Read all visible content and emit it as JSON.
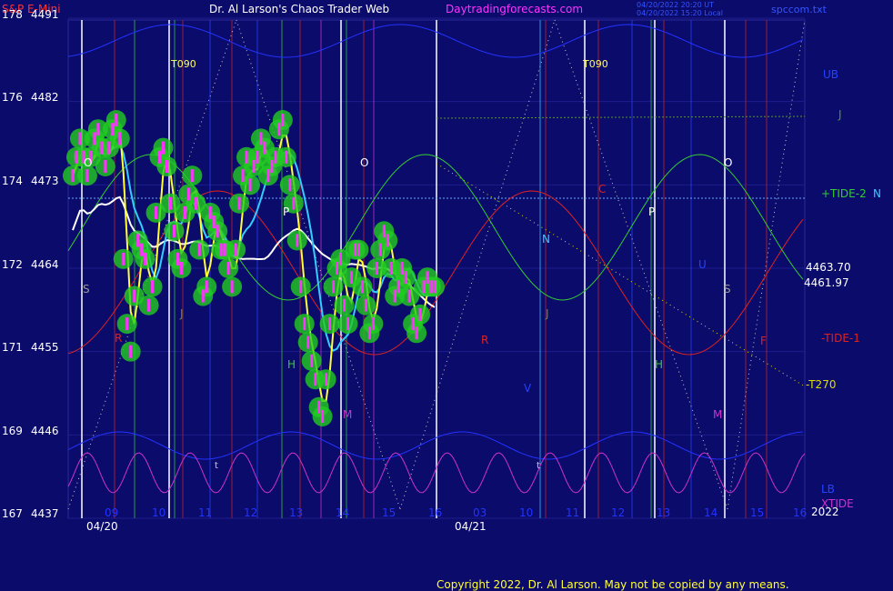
{
  "header": {
    "instrument": "S&P E-Mini",
    "author": "Dr. Al Larson's Chaos Trader Web",
    "site": "Daytradingforecasts.com",
    "stamp_line1": "04/20/2022 20:20 UT",
    "stamp_line2": "04/20/2022 15:20 Local",
    "file": "spccom.txt"
  },
  "copyright": "Copyright 2022, Dr. Al Larson. May not be copied by any means.",
  "colors": {
    "background": "#0b0b6b",
    "price_candles": "#ff33ff",
    "price_glow": "#22cc22",
    "fast_ma": "#ffff33",
    "mid_ma": "#33ccff",
    "slow_ma": "#ffffff",
    "upper_band": "#2233ff",
    "tide2": "#33cc33",
    "tide1": "#dd2222",
    "xtide": "#cc33cc",
    "neutral_line": "#66aaff",
    "j_line": "#559922",
    "t270_line": "#dddd00"
  },
  "chart_data": {
    "type": "line",
    "title": "S&P E-Mini",
    "y_axis_left": {
      "price_ticks": [
        4491,
        4482,
        4473,
        4464,
        4455,
        4446,
        4437
      ],
      "alt_ticks": [
        178,
        176,
        174,
        172,
        171,
        169,
        167
      ]
    },
    "x_axis": {
      "session1_date": "04/20",
      "session2_date": "04/21",
      "session1_hours": [
        "09",
        "10",
        "11",
        "12",
        "13",
        "14",
        "15",
        "16"
      ],
      "session2_hours": [
        "03",
        "10",
        "11",
        "12",
        "13",
        "14",
        "15",
        "16"
      ],
      "year": "2022"
    },
    "right_labels": {
      "ub": "UB",
      "j": "J",
      "tide2": "+TIDE-2",
      "n": "N",
      "price_a": "4463.70",
      "price_b": "4461.97",
      "tide1": "-TIDE-1",
      "t270": "-T270",
      "lb": "LB",
      "xtide": "XTIDE"
    },
    "markers": {
      "t090_left": "T090",
      "t090_right": "T090",
      "o": "O",
      "p": "P",
      "s": "S",
      "j": "J",
      "h": "H",
      "m": "M",
      "r": "R",
      "n": "N",
      "c": "C",
      "v": "V",
      "f": "F",
      "u": "U",
      "t": "t"
    },
    "price_series": {
      "name": "S&P E-Mini",
      "x": [
        0,
        2,
        4,
        6,
        8,
        10,
        12,
        14,
        16,
        18,
        20,
        22,
        24,
        26,
        28,
        30,
        32,
        34,
        36,
        38,
        40,
        42,
        44,
        46,
        48,
        50,
        52,
        54,
        56,
        58,
        60,
        62,
        64,
        66,
        68,
        70,
        72,
        74,
        76,
        78,
        80,
        82,
        84,
        86,
        88,
        90,
        92,
        94,
        96,
        98,
        100,
        102,
        104,
        106,
        108,
        110,
        112,
        114,
        116,
        118,
        120,
        122,
        124,
        126,
        128,
        130,
        132,
        134,
        136,
        138,
        140,
        142,
        144,
        146,
        148,
        150,
        152,
        154,
        156,
        158,
        160,
        162,
        164,
        166,
        168,
        170,
        172,
        174,
        176,
        178,
        180,
        182,
        184,
        186,
        188,
        190,
        192,
        194,
        196,
        198,
        200
      ],
      "y": [
        4474,
        4476,
        4478,
        4476,
        4474,
        4476,
        4478,
        4479,
        4477,
        4475,
        4477,
        4479,
        4480,
        4478,
        4465,
        4458,
        4455,
        4461,
        4467,
        4466,
        4465,
        4460,
        4462,
        4470,
        4476,
        4477,
        4475,
        4471,
        4468,
        4465,
        4464,
        4470,
        4472,
        4474,
        4471,
        4466,
        4461,
        4462,
        4470,
        4469,
        4468,
        4466,
        4466,
        4464,
        4462,
        4466,
        4471,
        4474,
        4476,
        4473,
        4475,
        4476,
        4478,
        4477,
        4474,
        4475,
        4476,
        4479,
        4480,
        4476,
        4473,
        4471,
        4467,
        4462,
        4458,
        4456,
        4454,
        4452,
        4449,
        4448,
        4452,
        4458,
        4462,
        4464,
        4465,
        4460,
        4458,
        4463,
        4466,
        4466,
        4462,
        4460,
        4457,
        4458,
        4464,
        4466,
        4468,
        4467,
        4464,
        4461,
        4462,
        4464,
        4463,
        4461,
        4458,
        4457,
        4459,
        4462,
        4463,
        4462,
        4462
      ],
      "range": [
        4437,
        4491
      ]
    }
  }
}
